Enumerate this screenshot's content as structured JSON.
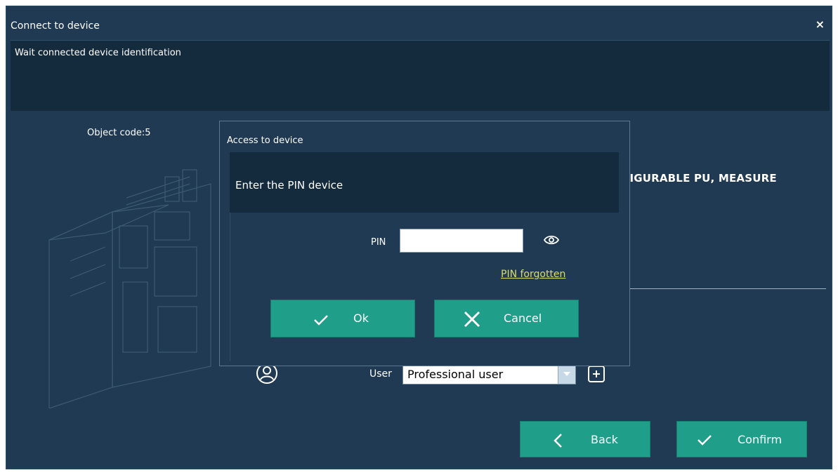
{
  "window": {
    "title": "Connect to device",
    "close_glyph": "×"
  },
  "header": {
    "text": "Wait connected device  identification"
  },
  "device": {
    "object_code": "Object code:5",
    "name": "FIGURABLE PU, MEASURE"
  },
  "user": {
    "label": "User",
    "selected": "Professional user"
  },
  "buttons": {
    "back": "Back",
    "confirm": "Confirm"
  },
  "dialog": {
    "title": "Access to device",
    "prompt": "Enter the PIN device",
    "pin_label": "PIN",
    "pin_value": "",
    "forgot_link": "PIN forgotten",
    "ok": "Ok",
    "cancel": "Cancel"
  },
  "colors": {
    "background": "#1f3a52",
    "header": "#142b3e",
    "accent": "#1f9e8a",
    "link": "#d9dd6a"
  }
}
